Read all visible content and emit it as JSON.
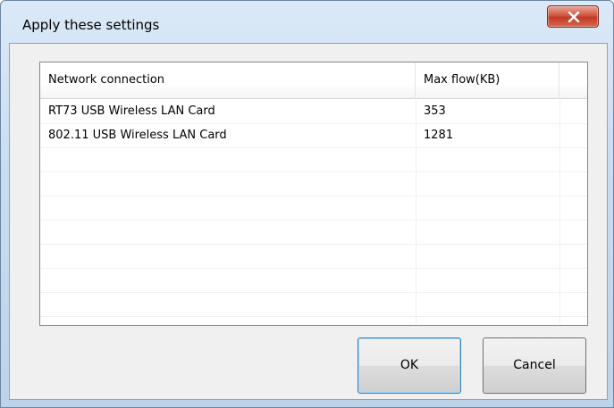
{
  "window": {
    "title": "Apply these settings"
  },
  "table": {
    "columns": [
      "Network connection",
      "Max flow(KB)"
    ],
    "rows": [
      {
        "name": "RT73 USB Wireless LAN Card",
        "max_flow": "353"
      },
      {
        "name": "802.11 USB Wireless LAN Card",
        "max_flow": "1281"
      }
    ]
  },
  "buttons": {
    "ok": "OK",
    "cancel": "Cancel"
  },
  "icons": {
    "close": "close-icon"
  },
  "colors": {
    "close_button": "#c8442f",
    "titlebar": "#c9ddf1"
  }
}
